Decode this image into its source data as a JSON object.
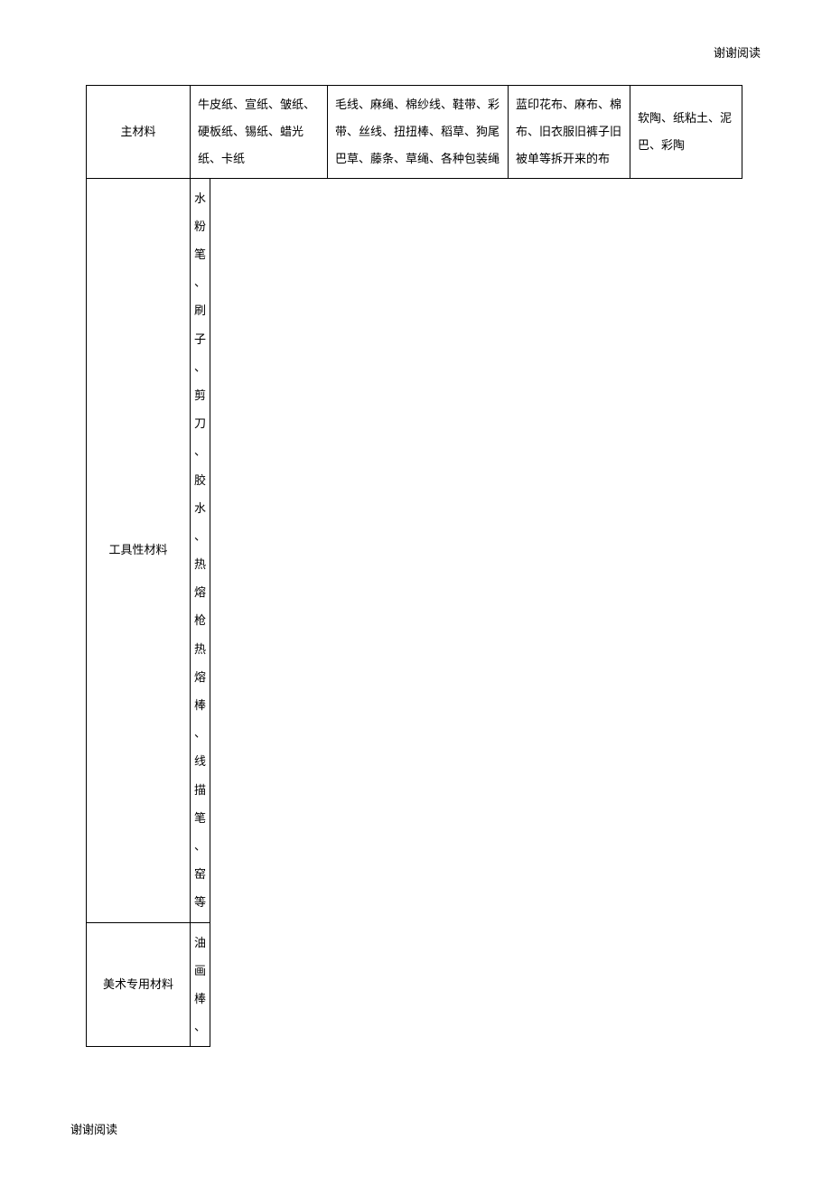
{
  "header": {
    "right": "谢谢阅读"
  },
  "footer": {
    "left": "谢谢阅读"
  },
  "table": {
    "row1": {
      "label": "主材料",
      "c2": "牛皮纸、宣纸、皱纸、硬板纸、锡纸、蜡光纸、卡纸",
      "c3": "毛线、麻绳、棉纱线、鞋带、彩带、丝线、扭扭棒、稻草、狗尾巴草、藤条、草绳、各种包装绳",
      "c4": "蓝印花布、麻布、棉布、旧衣服旧裤子旧被单等拆开来的布",
      "c5": "软陶、纸粘土、泥巴、彩陶"
    },
    "row2": {
      "label": "工具性材料",
      "narrow_chars": [
        "水",
        "粉",
        "笔",
        "、",
        "刷",
        "子",
        "、",
        "剪",
        "刀",
        "、",
        "胶",
        "水",
        "、",
        "热",
        "熔",
        "枪",
        "热",
        "熔",
        "棒",
        "、",
        "线",
        "描",
        "笔",
        "、",
        "窑",
        "等"
      ]
    },
    "row3": {
      "label": "美术专用材料",
      "narrow_chars": [
        "油",
        "画",
        "棒",
        "、"
      ]
    }
  }
}
